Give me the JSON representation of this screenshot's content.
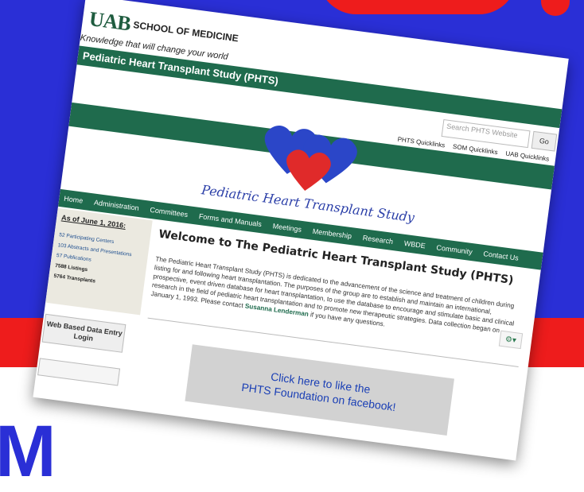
{
  "header": {
    "logo_mark": "UAB",
    "logo_school": "SCHOOL OF MEDICINE",
    "tagline": "Knowledge that will change your world",
    "site_title": "Pediatric Heart Transplant Study (PHTS)"
  },
  "search": {
    "placeholder": "Search PHTS Website",
    "go_label": "Go"
  },
  "quicklinks": [
    "PHTS Quicklinks",
    "SOM Quicklinks",
    "UAB Quicklinks"
  ],
  "banner": {
    "script_title": "Pediatric Heart Transplant Study"
  },
  "nav": [
    "Home",
    "Administration",
    "Committees",
    "Forms and Manuals",
    "Meetings",
    "Membership",
    "Research",
    "WBDE",
    "Community",
    "Contact Us"
  ],
  "sidebar": {
    "stats_heading": "As of June 1, 2016:",
    "stats": [
      "52 Participating Centers",
      "103 Abstracts and Presentations",
      "57 Publications",
      "7588 Listings",
      "5764 Transplants"
    ],
    "wbde_button": "Web Based Data Entry Login"
  },
  "main": {
    "welcome_title": "Welcome to The Pediatric Heart Transplant Study (PHTS)",
    "body_text": "The Pediatric Heart Transplant Study (PHTS) is dedicated to the advancement of the science and treatment of children during listing for and following heart transplantation. The purposes of the group are to establish and maintain an international, prospective, event driven database for heart transplantation, to use the database to encourage and stimulate basic and clinical research in the field of pediatric heart transplantation and to promote new therapeutic strategies. Data collection began on January 1, 1993. Please contact ",
    "contact_name": "Susanna Lenderman",
    "body_tail": " if you have any questions.",
    "fb_line1": "Click here to like the",
    "fb_line2": "PHTS Foundation on facebook!"
  },
  "colors": {
    "green": "#1f6b4d",
    "bg_blue": "#2a2fd6",
    "bg_red": "#ee1c1c"
  }
}
